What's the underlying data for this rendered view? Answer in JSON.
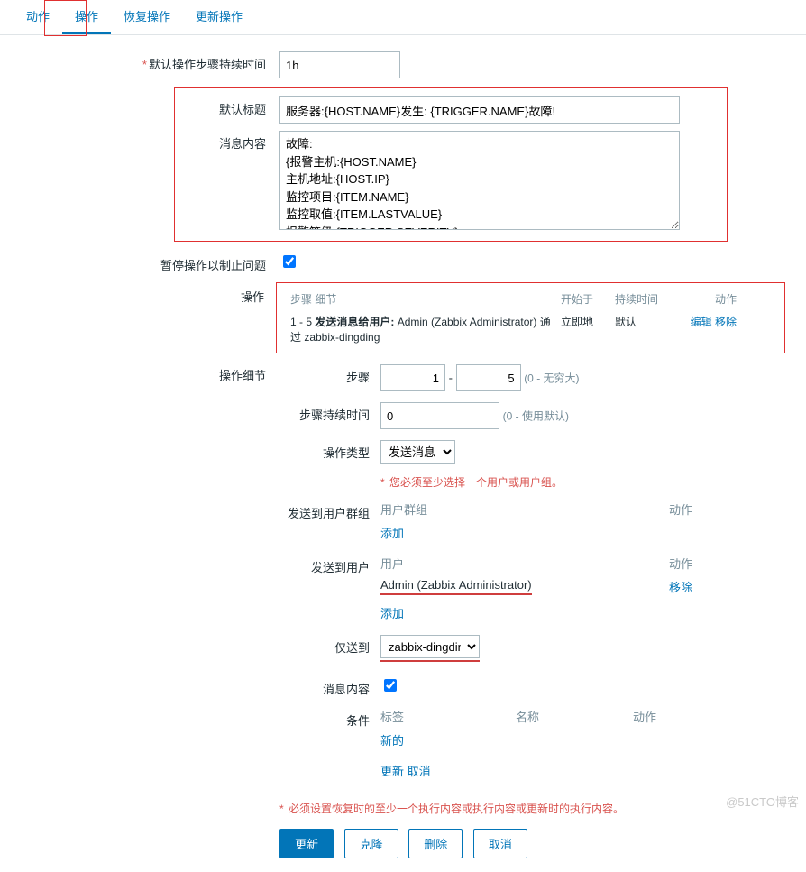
{
  "tabs": {
    "t0": "动作",
    "t1": "操作",
    "t2": "恢复操作",
    "t3": "更新操作"
  },
  "labels": {
    "default_step_duration": "默认操作步骤持续时间",
    "default_subject": "默认标题",
    "message_content": "消息内容",
    "pause": "暂停操作以制止问题",
    "operations": "操作",
    "op_details": "操作细节",
    "steps": "步骤",
    "step_duration": "步骤持续时间",
    "op_type": "操作类型",
    "send_to_groups": "发送到用户群组",
    "send_to_users": "发送到用户",
    "send_only_to": "仅送到",
    "msg_content": "消息内容",
    "conditions": "条件"
  },
  "fields": {
    "duration": "1h",
    "subject": "服务器:{HOST.NAME}发生: {TRIGGER.NAME}故障!",
    "message": "故障:\n{报警主机:{HOST.NAME}\n主机地址:{HOST.IP}\n监控项目:{ITEM.NAME}\n监控取值:{ITEM.LASTVALUE}\n报警等级:{TRIGGER.SEVERITY}\n当前状态:{TRIGGER.STATUS}",
    "step_from": "1",
    "step_to": "5",
    "step_duration": "0",
    "op_type": "发送消息",
    "send_to": "zabbix-dingding"
  },
  "hints": {
    "step_inf": "(0 - 无穷大)",
    "step_def": "(0 - 使用默认)"
  },
  "ops_head": {
    "step": "步骤",
    "detail": "细节",
    "start": "开始于",
    "dur": "持续时间",
    "act": "动作"
  },
  "ops_row": {
    "range": "1 - 5",
    "bold": "发送消息给用户:",
    "after": " Admin (Zabbix Administrator) 通过 zabbix-dingding",
    "start": "立即地",
    "dur": "默认",
    "edit": "编辑",
    "remove": "移除"
  },
  "tbl_head": {
    "grp": "用户群组",
    "user": "用户",
    "act": "动作",
    "label": "标签",
    "name": "名称"
  },
  "users": {
    "u0": "Admin (Zabbix Administrator)"
  },
  "links": {
    "add": "添加",
    "remove": "移除",
    "new": "新的",
    "update": "更新",
    "cancel": "取消"
  },
  "warn1": "您必须至少选择一个用户或用户组。",
  "warn2": "必须设置恢复时的至少一个执行内容或执行内容或更新时的执行内容。",
  "buttons": {
    "update": "更新",
    "clone": "克隆",
    "delete": "删除",
    "cancel": "取消"
  },
  "watermark": "@51CTO博客"
}
